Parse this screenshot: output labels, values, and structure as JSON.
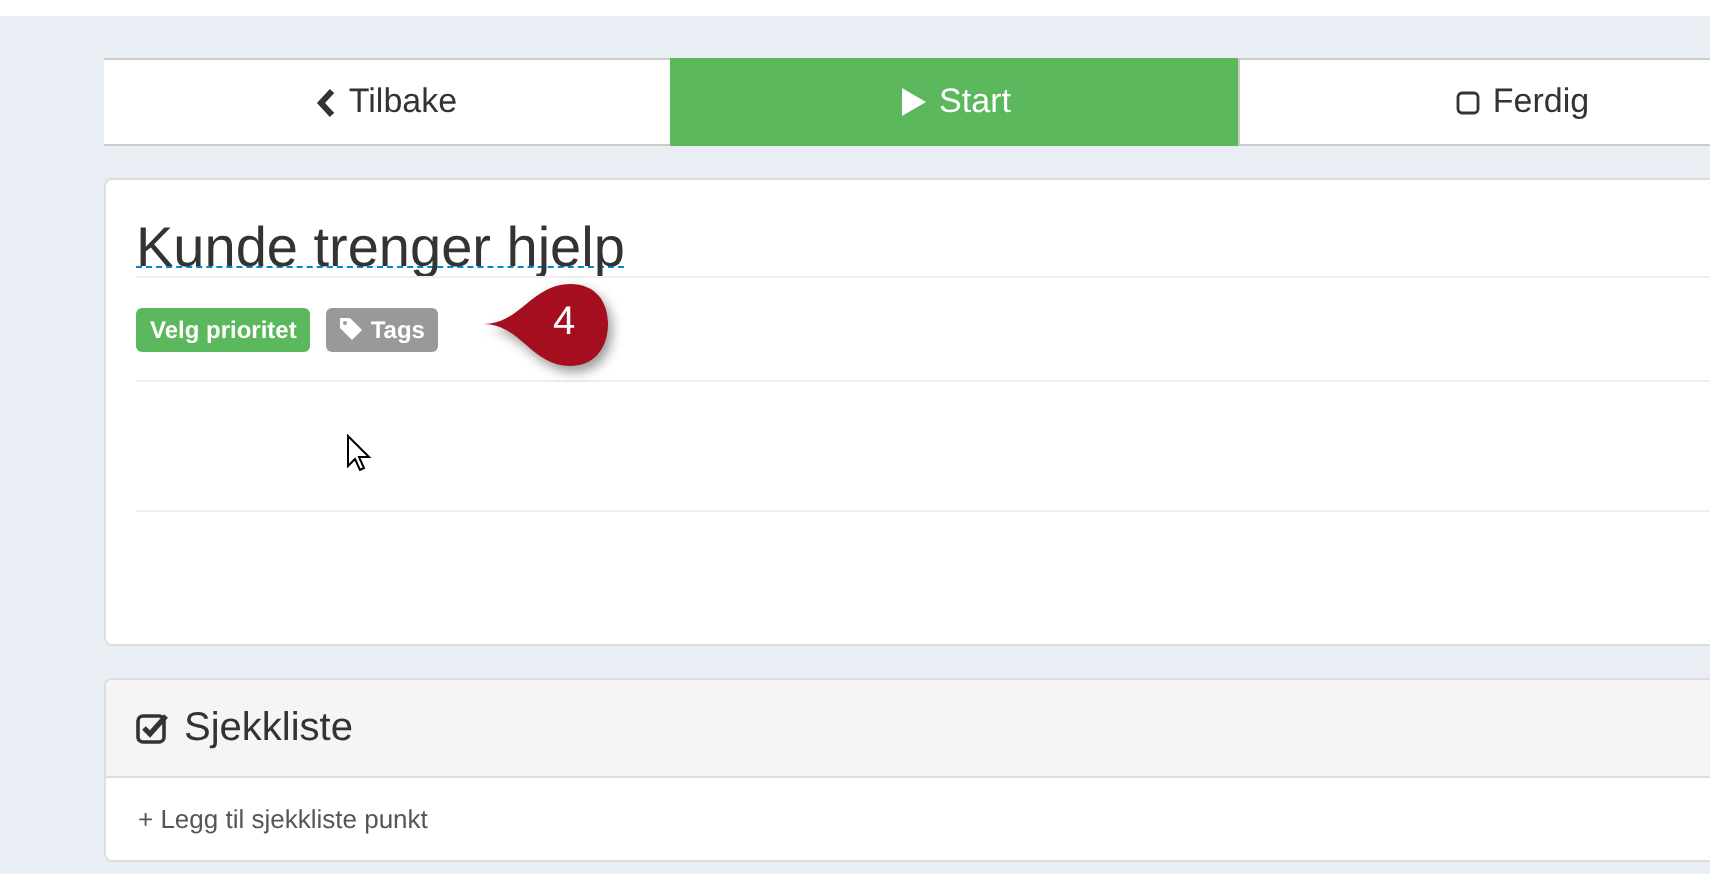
{
  "nav_buttons": [
    {
      "kind": "back",
      "label": "Tilbake",
      "selected": false
    },
    {
      "kind": "play",
      "label": "Start",
      "selected": true
    },
    {
      "kind": "checkbox",
      "label": "Ferdig",
      "selected": false
    }
  ],
  "task": {
    "title": "Kunde trenger hjelp",
    "badges": [
      {
        "kind": "priority",
        "label": "Velg prioritet",
        "color": "#5cb85c"
      },
      {
        "kind": "tags",
        "label": "Tags",
        "color": "#999999"
      }
    ],
    "callout": "4"
  },
  "checklist": {
    "title": "Sjekkliste",
    "add_link": "+ Legg til sjekkliste punkt"
  }
}
